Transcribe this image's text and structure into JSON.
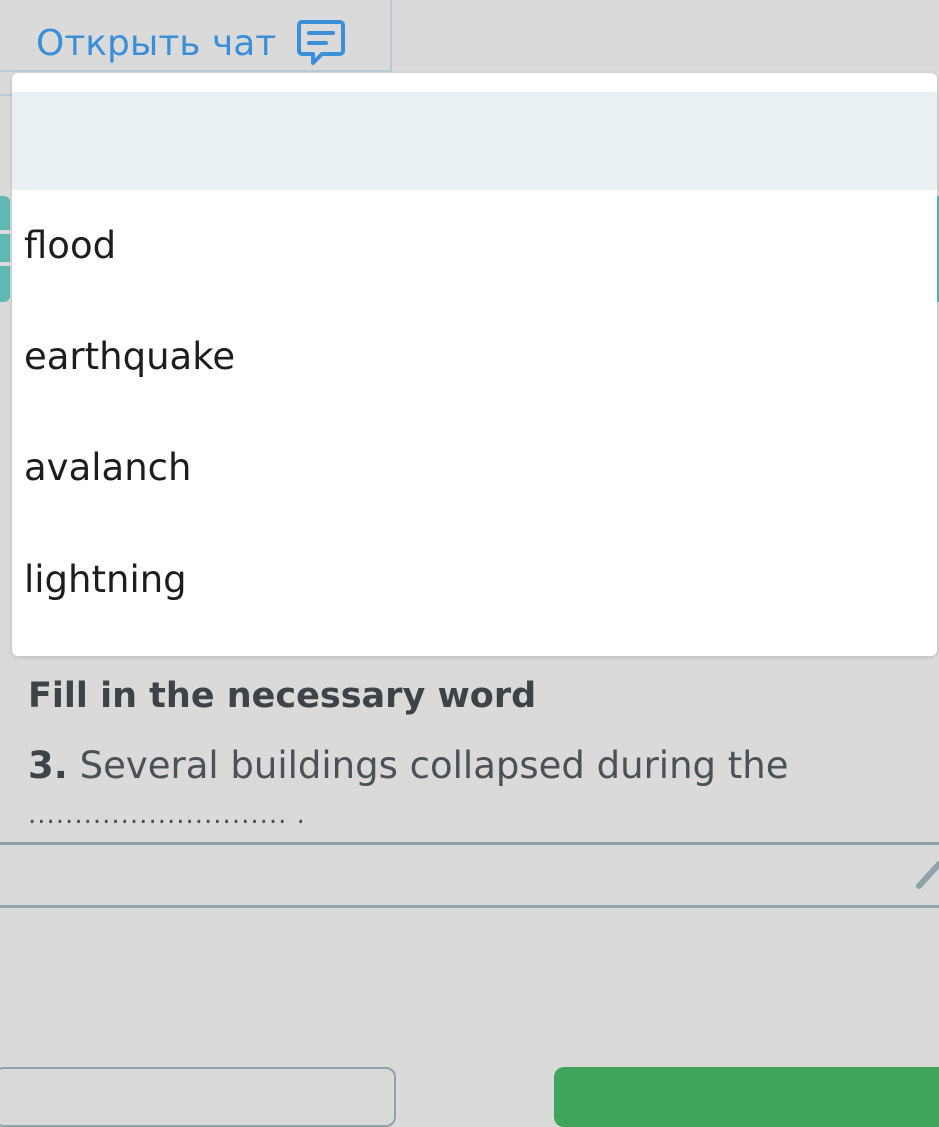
{
  "header": {
    "chat_link_label": "Открыть чат",
    "chat_icon": "chat-bubble-icon",
    "accent_color": "#3a8fd8"
  },
  "dropdown": {
    "selected_value": "",
    "options": [
      "flood",
      "earthquake",
      "avalanch",
      "lightning"
    ]
  },
  "question": {
    "instruction": "Fill in the necessary word",
    "number": "3.",
    "text": "Several buildings collapsed during the",
    "blank": "............................ ."
  },
  "answer": {
    "value": "",
    "edit_icon": "pencil-icon"
  },
  "colors": {
    "teal": "#5fb8b2",
    "green": "#3fa55a",
    "background": "#dadada"
  }
}
